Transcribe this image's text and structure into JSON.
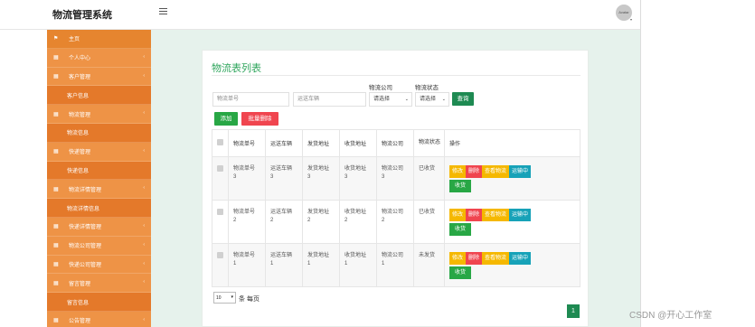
{
  "app": {
    "title": "物流管理系统",
    "avatar_text": "Avatar"
  },
  "sidebar": {
    "items": [
      {
        "label": "主页",
        "icon": "flag-icon",
        "type": "home"
      },
      {
        "label": "个人中心",
        "icon": "grid-icon",
        "type": "parent"
      },
      {
        "label": "客户管理",
        "icon": "grid-icon",
        "type": "parent"
      },
      {
        "label": "客户信息",
        "type": "child"
      },
      {
        "label": "物流管理",
        "icon": "grid-icon",
        "type": "parent"
      },
      {
        "label": "物流信息",
        "type": "child"
      },
      {
        "label": "快递管理",
        "icon": "grid-icon",
        "type": "parent"
      },
      {
        "label": "快递信息",
        "type": "child"
      },
      {
        "label": "物流详情管理",
        "icon": "grid-icon",
        "type": "parent"
      },
      {
        "label": "物流详情信息",
        "type": "child"
      },
      {
        "label": "快递详情管理",
        "icon": "grid-icon",
        "type": "parent"
      },
      {
        "label": "物流公司管理",
        "icon": "grid-icon",
        "type": "parent"
      },
      {
        "label": "快递公司管理",
        "icon": "grid-icon",
        "type": "parent"
      },
      {
        "label": "留言管理",
        "icon": "grid-icon",
        "type": "parent"
      },
      {
        "label": "留言信息",
        "type": "child"
      },
      {
        "label": "公告管理",
        "icon": "grid-icon",
        "type": "parent"
      }
    ]
  },
  "page": {
    "title": "物流表列表"
  },
  "filters": {
    "order_no_placeholder": "物流单号",
    "vehicle_placeholder": "运送车辆",
    "company_label": "物流公司",
    "company_value": "请选择",
    "status_label": "物流状态",
    "status_value": "请选择",
    "search_label": "查询"
  },
  "actions": {
    "add_label": "添加",
    "batch_delete_label": "批量删除"
  },
  "table": {
    "headers": [
      "物流单号",
      "运送车辆",
      "发货地址",
      "收货地址",
      "物流公司",
      "物流状态",
      "操作"
    ],
    "rows": [
      {
        "order_no": "物流单号\n3",
        "vehicle": "运送车辆\n3",
        "from": "发货地址\n3",
        "to": "收货地址\n3",
        "company": "物流公司\n3",
        "status": "已收货"
      },
      {
        "order_no": "物流单号\n2",
        "vehicle": "运送车辆\n2",
        "from": "发货地址\n2",
        "to": "收货地址\n2",
        "company": "物流公司\n2",
        "status": "已收货"
      },
      {
        "order_no": "物流单号\n1",
        "vehicle": "运送车辆\n1",
        "from": "发货地址\n1",
        "to": "收货地址\n1",
        "company": "物流公司\n1",
        "status": "未发货"
      }
    ],
    "row_actions": {
      "edit": "修改",
      "delete": "删除",
      "view": "查看物流",
      "transit": "运输中",
      "receive": "收货"
    }
  },
  "pagination": {
    "page_size": "10",
    "page_size_suffix": "条 每页",
    "current_page": "1"
  },
  "watermark": "CSDN @开心工作室",
  "colors": {
    "sidebar": "#ea8c3b",
    "accent_green": "#2ea55c",
    "button_green": "#28a745",
    "button_red": "#f0454f",
    "button_yellow": "#f5b800",
    "button_cyan": "#17a2b8"
  }
}
